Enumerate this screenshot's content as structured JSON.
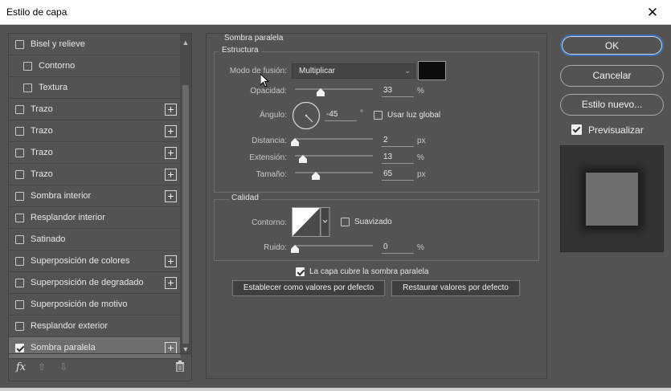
{
  "window": {
    "title": "Estilo de capa",
    "close_glyph": "✕"
  },
  "sidebar": {
    "items": [
      {
        "label": "Bisel y relieve",
        "checked": false,
        "plus": false,
        "sub": false
      },
      {
        "label": "Contorno",
        "checked": false,
        "plus": false,
        "sub": true
      },
      {
        "label": "Textura",
        "checked": false,
        "plus": false,
        "sub": true
      },
      {
        "label": "Trazo",
        "checked": false,
        "plus": true,
        "sub": false
      },
      {
        "label": "Trazo",
        "checked": false,
        "plus": true,
        "sub": false
      },
      {
        "label": "Trazo",
        "checked": false,
        "plus": true,
        "sub": false
      },
      {
        "label": "Trazo",
        "checked": false,
        "plus": true,
        "sub": false
      },
      {
        "label": "Sombra interior",
        "checked": false,
        "plus": true,
        "sub": false
      },
      {
        "label": "Resplandor interior",
        "checked": false,
        "plus": false,
        "sub": false
      },
      {
        "label": "Satinado",
        "checked": false,
        "plus": false,
        "sub": false
      },
      {
        "label": "Superposición de colores",
        "checked": false,
        "plus": true,
        "sub": false
      },
      {
        "label": "Superposición de degradado",
        "checked": false,
        "plus": true,
        "sub": false
      },
      {
        "label": "Superposición de motivo",
        "checked": false,
        "plus": false,
        "sub": false
      },
      {
        "label": "Resplandor exterior",
        "checked": false,
        "plus": false,
        "sub": false
      },
      {
        "label": "Sombra paralela",
        "checked": true,
        "plus": true,
        "sub": false,
        "active": true
      }
    ],
    "plus_glyph": "+",
    "footer": {
      "fx": "fx",
      "up_glyph": "⇧",
      "down_glyph": "⇩"
    }
  },
  "main": {
    "section_title": "Sombra paralela",
    "estructura": {
      "title": "Estructura",
      "blend_label": "Modo de fusión:",
      "blend_value": "Multiplicar",
      "color": "#0d0d0d",
      "opacity_label": "Opacidad:",
      "opacity_value": "33",
      "opacity_unit": "%",
      "opacity_fraction": 0.33,
      "angle_label": "Ángulo:",
      "angle_value": "-45",
      "angle_unit": "°",
      "global_light_label": "Usar luz global",
      "global_light_checked": false,
      "distance_label": "Distancia:",
      "distance_value": "2",
      "distance_unit": "px",
      "distance_fraction": 0.0,
      "spread_label": "Extensión:",
      "spread_value": "13",
      "spread_unit": "%",
      "spread_fraction": 0.1,
      "size_label": "Tamaño:",
      "size_value": "65",
      "size_unit": "px",
      "size_fraction": 0.27
    },
    "calidad": {
      "title": "Calidad",
      "contour_label": "Contorno:",
      "antialias_label": "Suavizado",
      "antialias_checked": false,
      "noise_label": "Ruido:",
      "noise_value": "0",
      "noise_unit": "%",
      "noise_fraction": 0.0
    },
    "knockout_label": "La capa cubre la sombra paralela",
    "knockout_checked": true,
    "set_default_label": "Establecer como valores por defecto",
    "reset_default_label": "Restaurar valores por defecto"
  },
  "actions": {
    "ok_label": "OK",
    "cancel_label": "Cancelar",
    "new_style_label": "Estilo nuevo...",
    "preview_label": "Previsualizar",
    "preview_checked": true
  },
  "colors": {
    "accent": "#3b6fb3",
    "panel": "#535353"
  }
}
